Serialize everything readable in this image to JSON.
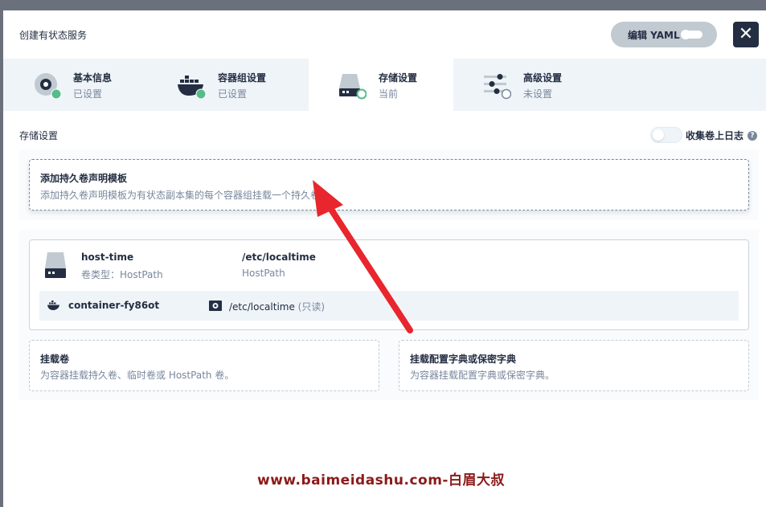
{
  "header": {
    "title": "创建有状态服务",
    "yaml_button": "编辑 YAML",
    "close_icon": "close-icon"
  },
  "tabs": [
    {
      "label": "基本信息",
      "status": "已设置",
      "icon": "disk-gear-icon",
      "state": "done"
    },
    {
      "label": "容器组设置",
      "status": "已设置",
      "icon": "docker-icon",
      "state": "done"
    },
    {
      "label": "存储设置",
      "status": "当前",
      "icon": "storage-icon",
      "state": "current"
    },
    {
      "label": "高级设置",
      "status": "未设置",
      "icon": "sliders-icon",
      "state": "pending"
    }
  ],
  "section": {
    "title": "存储设置",
    "log_toggle_label": "收集卷上日志",
    "log_toggle_on": false,
    "help_glyph": "?"
  },
  "add_template": {
    "title": "添加持久卷声明模板",
    "desc": "添加持久卷声明模板为有状态副本集的每个容器组挂载一个持久卷"
  },
  "volume": {
    "name": "host-time",
    "type_label": "卷类型：HostPath",
    "path": "/etc/localtime",
    "kind": "HostPath",
    "mount": {
      "container": "container-fy86ot",
      "path": "/etc/localtime",
      "readonly": "(只读)"
    }
  },
  "options": [
    {
      "title": "挂载卷",
      "desc": "为容器挂载持久卷、临时卷或 HostPath 卷。"
    },
    {
      "title": "挂载配置字典或保密字典",
      "desc": "为容器挂载配置字典或保密字典。"
    }
  ],
  "watermark": "www.baimeidashu.com-白眉大叔",
  "colors": {
    "dark": "#242e42",
    "muted": "#79879c",
    "success": "#55bc8a",
    "annotation_arrow": "#e8262d",
    "watermark": "#8b1a1a"
  }
}
